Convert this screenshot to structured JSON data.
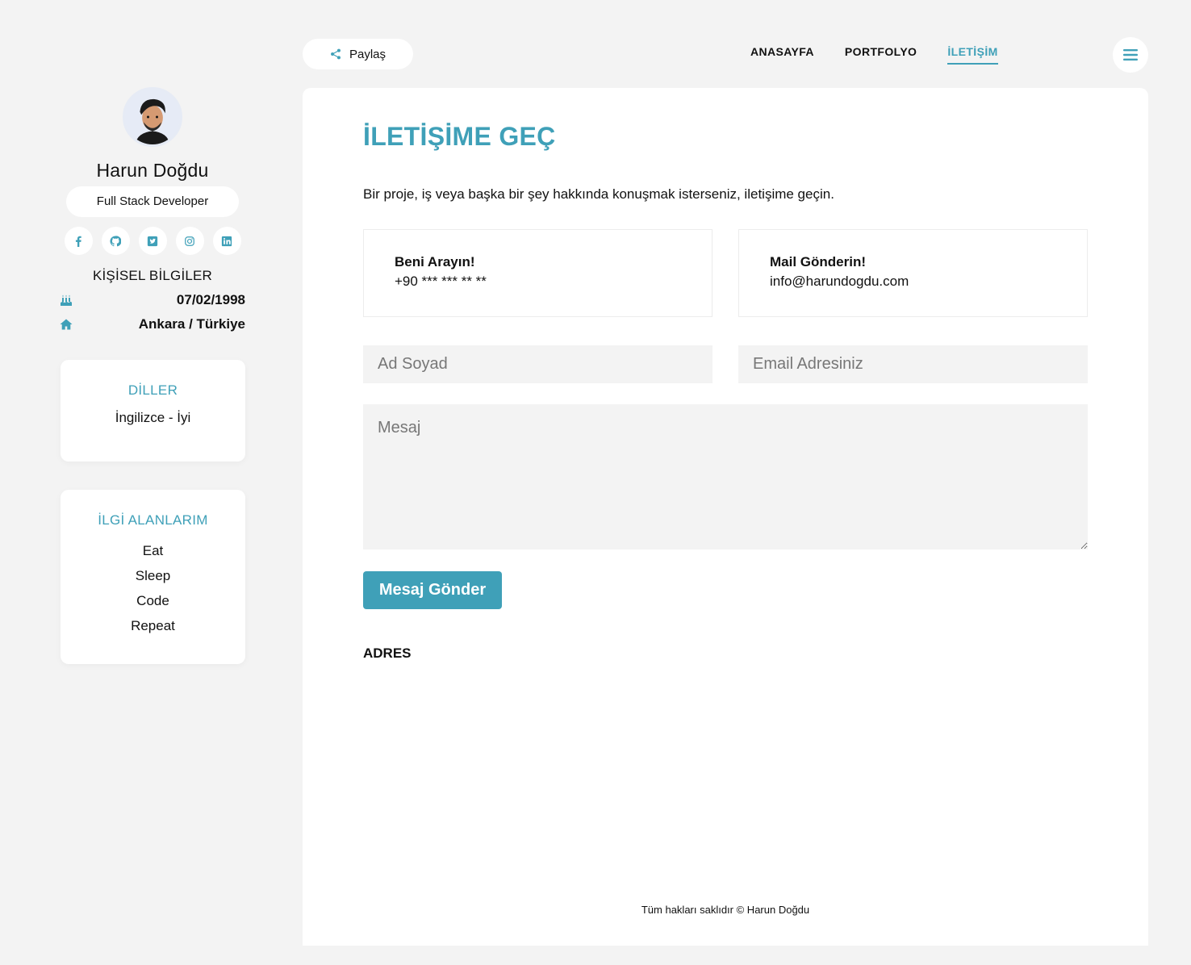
{
  "profile": {
    "name": "Harun Doğdu",
    "title": "Full Stack Developer",
    "socials": [
      "facebook-icon",
      "github-icon",
      "twitter-icon",
      "instagram-icon",
      "linkedin-icon"
    ]
  },
  "personal": {
    "heading": "KİŞİSEL BİLGİLER",
    "birthday": "07/02/1998",
    "location": "Ankara / Türkiye"
  },
  "languages": {
    "heading": "DİLLER",
    "items": [
      "İngilizce - İyi"
    ]
  },
  "interests": {
    "heading": "İLGİ ALANLARIM",
    "items": [
      "Eat",
      "Sleep",
      "Code",
      "Repeat"
    ]
  },
  "topbar": {
    "share_label": "Paylaş",
    "nav": [
      "ANASAYFA",
      "PORTFOLYO",
      "İLETİŞİM"
    ],
    "active_nav": "İLETİŞİM"
  },
  "contact": {
    "title": "İLETİŞİME GEÇ",
    "intro": "Bir proje, iş veya başka bir şey hakkında konuşmak isterseniz, iletişime geçin.",
    "phone_label": "Beni Arayın!",
    "phone_value": "+90 *** *** ** **",
    "mail_label": "Mail Gönderin!",
    "mail_value": "info@harundogdu.com",
    "name_placeholder": "Ad Soyad",
    "email_placeholder": "Email Adresiniz",
    "message_placeholder": "Mesaj",
    "send_label": "Mesaj Gönder",
    "address_heading": "ADRES"
  },
  "footer": {
    "copyright": "Tüm hakları saklıdır © Harun Doğdu"
  },
  "colors": {
    "accent": "#3fa0b8",
    "background": "#f3f3f3",
    "panel": "#ffffff"
  }
}
